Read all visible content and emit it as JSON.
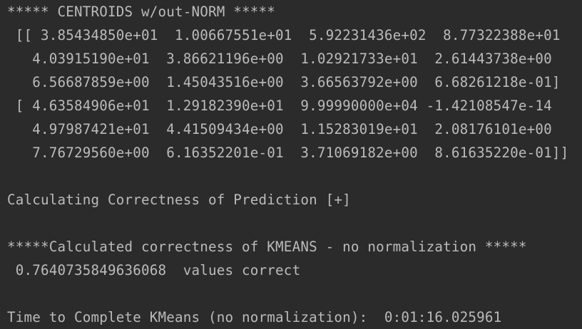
{
  "console": {
    "lines": [
      "***** CENTROIDS w/out-NORM *****",
      " [[ 3.85434850e+01  1.00667551e+01  5.92231436e+02  8.77322388e+01",
      "   4.03915190e+01  3.86621196e+00  1.02921733e+01  2.61443738e+00",
      "   6.56687859e+00  1.45043516e+00  3.66563792e+00  6.68261218e-01]",
      " [ 4.63584906e+01  1.29182390e+01  9.99990000e+04 -1.42108547e-14",
      "   4.97987421e+01  4.41509434e+00  1.15283019e+01  2.08176101e+00",
      "   7.76729560e+00  6.16352201e-01  3.71069182e+00  8.61635220e-01]]",
      "",
      "Calculating Correctness of Prediction [+]",
      "",
      "*****Calculated correctness of KMEANS - no normalization *****",
      " 0.7640735849636068  values correct",
      "",
      "Time to Complete KMeans (no normalization):  0:01:16.025961"
    ]
  },
  "colors": {
    "background": "#2b2b2b",
    "text": "#bbbbbb"
  }
}
